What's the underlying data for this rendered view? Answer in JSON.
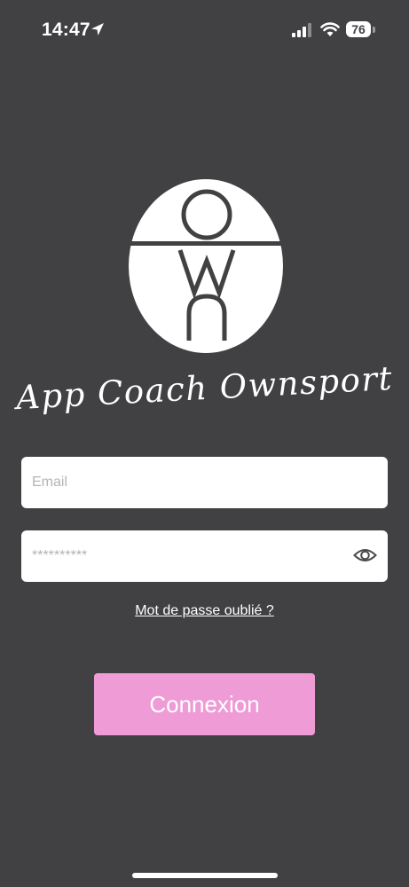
{
  "status_bar": {
    "time": "14:47",
    "battery_level": "76",
    "icons": [
      "location-arrow-icon",
      "signal-bars-icon",
      "wifi-icon",
      "battery-icon"
    ]
  },
  "branding": {
    "logo_icon": "ownsport-logo-icon",
    "app_title": "App Coach Ownsport"
  },
  "login_form": {
    "email_placeholder": "Email",
    "email_value": "",
    "password_placeholder": "**********",
    "password_value": "",
    "show_password_icon": "eye-icon",
    "forgot_password_label": "Mot de passe oublié ?",
    "submit_label": "Connexion"
  },
  "colors": {
    "background": "#414042",
    "field_background": "#ffffff",
    "button_background": "#ee9bd6",
    "text_on_dark": "#ffffff"
  }
}
